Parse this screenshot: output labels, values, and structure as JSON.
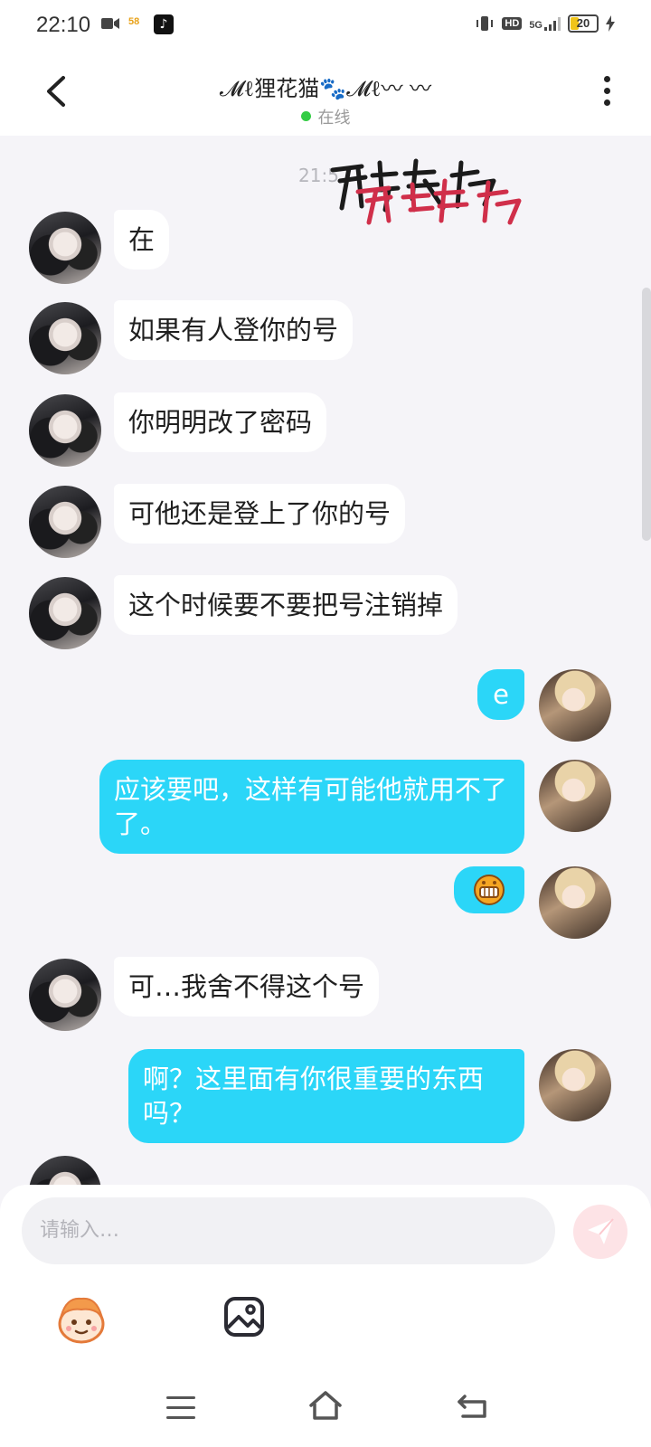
{
  "status_bar": {
    "time": "22:10",
    "badge_58": "58",
    "hd": "HD",
    "network": "5G",
    "battery": "20"
  },
  "header": {
    "title": "𝓜ℓ狸花猫🐾𝓜ℓ〰 〰",
    "status": "在线"
  },
  "chat": {
    "time_divider": "21:5",
    "messages": [
      {
        "side": "left",
        "text": "在"
      },
      {
        "side": "left",
        "text": "如果有人登你的号"
      },
      {
        "side": "left",
        "text": "你明明改了密码"
      },
      {
        "side": "left",
        "text": "可他还是登上了你的号"
      },
      {
        "side": "left",
        "text": "这个时候要不要把号注销掉"
      },
      {
        "side": "right",
        "text": "e"
      },
      {
        "side": "right",
        "text": "应该要吧，这样有可能他就用不了了。"
      },
      {
        "side": "right",
        "text": ""
      },
      {
        "side": "left",
        "text": "可…我舍不得这个号"
      },
      {
        "side": "right",
        "text": "啊？这里面有你很重要的东西吗？"
      }
    ]
  },
  "input": {
    "placeholder": "请输入…"
  },
  "colors": {
    "bubble_right": "#2bd6f8",
    "bubble_left": "#ffffff",
    "background": "#f5f4f8",
    "online": "#33cc44"
  }
}
